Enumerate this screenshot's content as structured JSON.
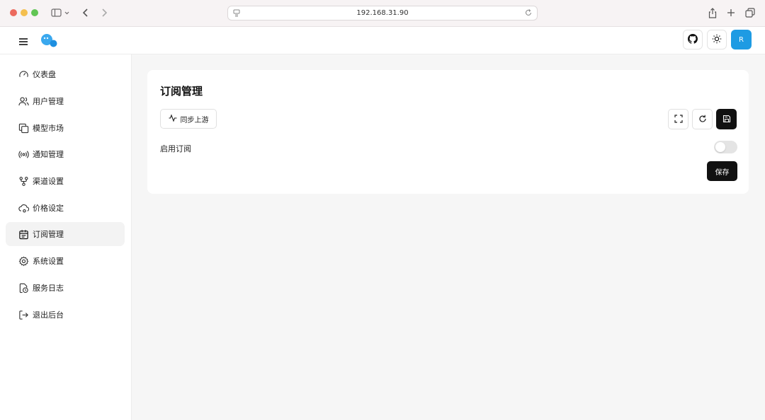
{
  "browser": {
    "url": "192.168.31.90"
  },
  "header": {
    "avatar_initial": "R",
    "accent_color": "#1e9be3"
  },
  "sidebar": {
    "items": [
      {
        "label": "仪表盘",
        "icon": "gauge-icon"
      },
      {
        "label": "用户管理",
        "icon": "users-icon"
      },
      {
        "label": "模型市场",
        "icon": "copy-icon"
      },
      {
        "label": "通知管理",
        "icon": "broadcast-icon"
      },
      {
        "label": "渠道设置",
        "icon": "git-fork-icon"
      },
      {
        "label": "价格设定",
        "icon": "cloud-cog-icon"
      },
      {
        "label": "订阅管理",
        "icon": "calendar-icon",
        "active": true
      },
      {
        "label": "系统设置",
        "icon": "gear-icon"
      },
      {
        "label": "服务日志",
        "icon": "file-clock-icon"
      },
      {
        "label": "退出后台",
        "icon": "logout-icon"
      }
    ]
  },
  "main": {
    "title": "订阅管理",
    "sync_label": "同步上游",
    "enable_label": "启用订阅",
    "enable_value": false,
    "save_label": "保存"
  }
}
